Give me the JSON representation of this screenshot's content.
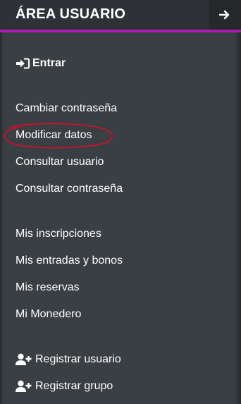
{
  "header": {
    "title": "ÁREA USUARIO",
    "arrow_icon": "arrow-right-icon",
    "accent_color": "#a61db0"
  },
  "menu": {
    "login": {
      "label": "Entrar",
      "icon": "sign-in-icon"
    },
    "account_items": [
      "Cambiar contraseña",
      "Modificar datos",
      "Consultar usuario",
      "Consultar contraseña"
    ],
    "personal_items": [
      "Mis inscripciones",
      "Mis entradas y bonos",
      "Mis reservas",
      "Mi Monedero"
    ],
    "register_items": [
      {
        "label": "Registrar usuario",
        "icon": "user-plus-icon"
      },
      {
        "label": "Registrar grupo",
        "icon": "user-plus-icon"
      }
    ]
  },
  "annotation": {
    "color": "#c8102e"
  }
}
